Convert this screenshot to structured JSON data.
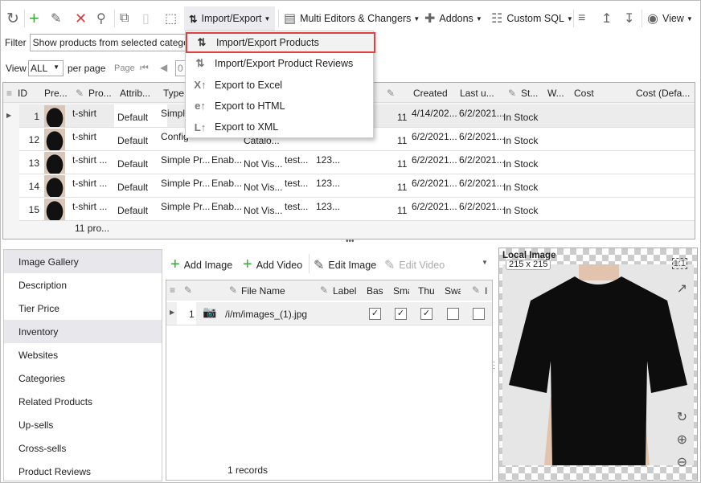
{
  "toolbar": {
    "import_export": "Import/Export",
    "multi_editors": "Multi Editors & Changers",
    "addons": "Addons",
    "custom_sql": "Custom SQL",
    "view": "View"
  },
  "filter": {
    "label": "Filter",
    "value": "Show products from selected catego"
  },
  "paging": {
    "view_label": "View",
    "view_value": "ALL",
    "per_page": "per page",
    "page_label": "Page",
    "page_value": "0"
  },
  "menu": {
    "items": [
      {
        "label": "Import/Export Products",
        "icon": "import-export-icon"
      },
      {
        "label": "Import/Export Product Reviews",
        "icon": "import-export-icon"
      },
      {
        "label": "Export to Excel",
        "icon": "excel-export-icon"
      },
      {
        "label": "Export  to HTML",
        "icon": "html-export-icon"
      },
      {
        "label": "Export to XML",
        "icon": "xml-export-icon"
      }
    ]
  },
  "grid": {
    "columns": [
      "ID",
      "Pre...",
      "Pro...",
      "Attrib...",
      "Type",
      "Created",
      "Last u...",
      "St...",
      "W...",
      "Cost",
      "Cost (Defa..."
    ],
    "rows": [
      {
        "id": "1",
        "name": "t-shirt",
        "attr": "Default",
        "type": "Simple",
        "status": "",
        "vis": "",
        "c1": "",
        "c2": "",
        "qty": "11",
        "created": "4/14/202...",
        "updated": "6/2/2021...",
        "stock": "In Stock"
      },
      {
        "id": "12",
        "name": "t-shirt",
        "attr": "Default",
        "type": "Config",
        "status": "",
        "vis": "Catalo...",
        "c1": "",
        "c2": "",
        "qty": "11",
        "created": "6/2/2021...",
        "updated": "6/2/2021...",
        "stock": "In Stock"
      },
      {
        "id": "13",
        "name": "t-shirt  ...",
        "attr": "Default",
        "type": "Simple Pr...",
        "status": "Enab...",
        "vis": "Not Vis...",
        "c1": "test...",
        "c2": "123...",
        "qty": "11",
        "created": "6/2/2021...",
        "updated": "6/2/2021...",
        "stock": "In Stock"
      },
      {
        "id": "14",
        "name": "t-shirt  ...",
        "attr": "Default",
        "type": "Simple Pr...",
        "status": "Enab...",
        "vis": "Not Vis...",
        "c1": "test...",
        "c2": "123...",
        "qty": "11",
        "created": "6/2/2021...",
        "updated": "6/2/2021...",
        "stock": "In Stock"
      },
      {
        "id": "15",
        "name": "t-shirt  ...",
        "attr": "Default",
        "type": "Simple Pr...",
        "status": "Enab...",
        "vis": "Not Vis...",
        "c1": "test...",
        "c2": "123...",
        "qty": "11",
        "created": "6/2/2021...",
        "updated": "6/2/2021...",
        "stock": "In Stock"
      }
    ],
    "footer": "11 pro..."
  },
  "sidebar": {
    "items": [
      "Image Gallery",
      "Description",
      "Tier Price",
      "Inventory",
      "Websites",
      "Categories",
      "Related Products",
      "Up-sells",
      "Cross-sells",
      "Product Reviews"
    ]
  },
  "gallery": {
    "add_image": "Add Image",
    "add_video": "Add Video",
    "edit_image": "Edit Image",
    "edit_video": "Edit Video",
    "columns": [
      "File Name",
      "Label",
      "Bas",
      "Sma",
      "Thu",
      "Swa",
      "I"
    ],
    "row": {
      "num": "1",
      "file": "/i/m/images_(1).jpg",
      "checks": [
        true,
        true,
        true,
        false,
        false
      ]
    },
    "footer": "1 records"
  },
  "image": {
    "title": "Local Image",
    "size": "215 x 215"
  }
}
